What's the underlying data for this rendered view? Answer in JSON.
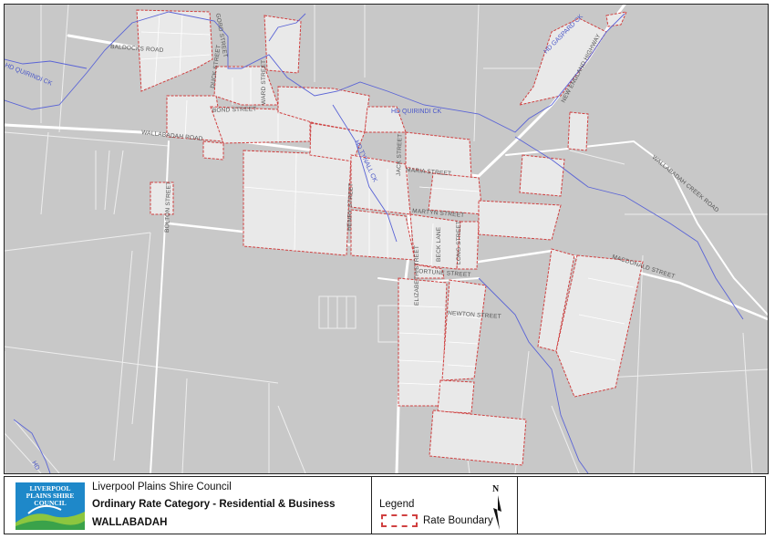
{
  "map": {
    "street_labels": [
      "BALDOCKS ROAD",
      "GORD STREET",
      "DUCK STREET",
      "WALLABADAH ROAD",
      "BOND STREET",
      "WARD STREET",
      "BOLTON STREET",
      "HENRY STREET",
      "MARIA STREET",
      "MARTYN STREET",
      "JACK STREET",
      "LONG STREET",
      "BECK LANE",
      "FORTUNE STREET",
      "ELIZABETH STREET",
      "NEWTON STREET",
      "MACDONALD STREET",
      "NEW ENGLAND HIGHWAY",
      "WALLABADAH CREEK ROAD"
    ],
    "water_labels": [
      "HD QUIRINDI CK",
      "HD QUIRINDI CK",
      "HD GASPARD CK",
      "HD TYNALL CK",
      "HD"
    ],
    "boundary_color": "#d04040",
    "water_color": "#5a64d6"
  },
  "footer": {
    "council_name": "Liverpool Plains Shire Council",
    "category": "Ordinary Rate Category - Residential & Business",
    "locality": "WALLABADAH",
    "logo_text": "LIVERPOOL PLAINS SHIRE COUNCIL",
    "legend_title": "Legend",
    "legend_item": "Rate Boundary",
    "north_label": "N"
  }
}
